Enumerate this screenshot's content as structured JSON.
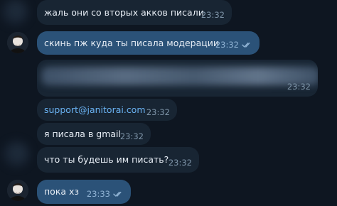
{
  "colors": {
    "background": "#0e1621",
    "incoming_bubble": "#182533",
    "outgoing_bubble": "#2b5278",
    "link": "#6ab2f2",
    "meta_in": "#7f95a9",
    "meta_out": "#8fb2d3"
  },
  "messages": [
    {
      "id": 1,
      "text": "жаль они со вторых акков писали",
      "time": "23:32",
      "direction": "in"
    },
    {
      "id": 2,
      "text": "скинь пж куда ты писала модерации",
      "time": "23:32",
      "direction": "out",
      "read": true
    },
    {
      "id": 3,
      "text": "",
      "time": "23:32",
      "direction": "in",
      "blurred": true
    },
    {
      "id": 4,
      "text": "support@janitorai.com",
      "time": "23:32",
      "direction": "in",
      "is_link": true
    },
    {
      "id": 5,
      "text": "я писала в gmail",
      "time": "23:32",
      "direction": "in"
    },
    {
      "id": 6,
      "text": "что ты будешь им писать?",
      "time": "23:32",
      "direction": "in"
    },
    {
      "id": 7,
      "text": "пока хз",
      "time": "23:33",
      "direction": "out",
      "read": true
    }
  ],
  "avatars": [
    {
      "label": "user-avatar"
    }
  ]
}
